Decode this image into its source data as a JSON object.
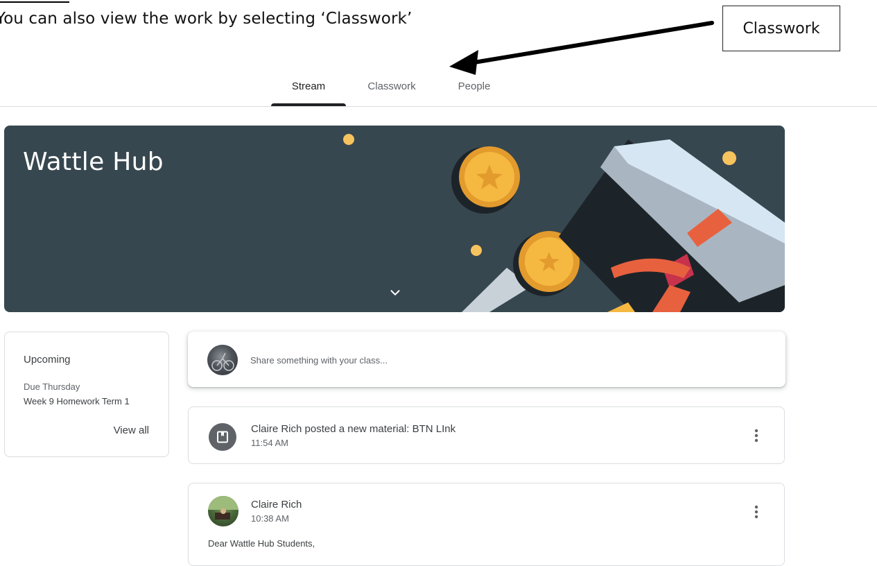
{
  "instruction": {
    "text": "You can also view the work by selecting ‘Classwork’",
    "callout_label": "Classwork"
  },
  "tabs": [
    {
      "label": "Stream",
      "active": true
    },
    {
      "label": "Classwork",
      "active": false
    },
    {
      "label": "People",
      "active": false
    }
  ],
  "banner": {
    "title": "Wattle Hub",
    "color": "#37474f"
  },
  "upcoming": {
    "title": "Upcoming",
    "due": "Due Thursday",
    "item": "Week 9 Homework Term 1",
    "view_all": "View all"
  },
  "share": {
    "placeholder": "Share something with your class..."
  },
  "posts": [
    {
      "title": "Claire Rich posted a new material: BTN LInk",
      "time": "11:54 AM",
      "icon": "material-icon"
    },
    {
      "author": "Claire Rich",
      "time": "10:38 AM",
      "body": "Dear Wattle Hub Students,"
    }
  ],
  "colors": {
    "accent": "#202124",
    "muted": "#5f6368",
    "border": "#dadce0"
  }
}
